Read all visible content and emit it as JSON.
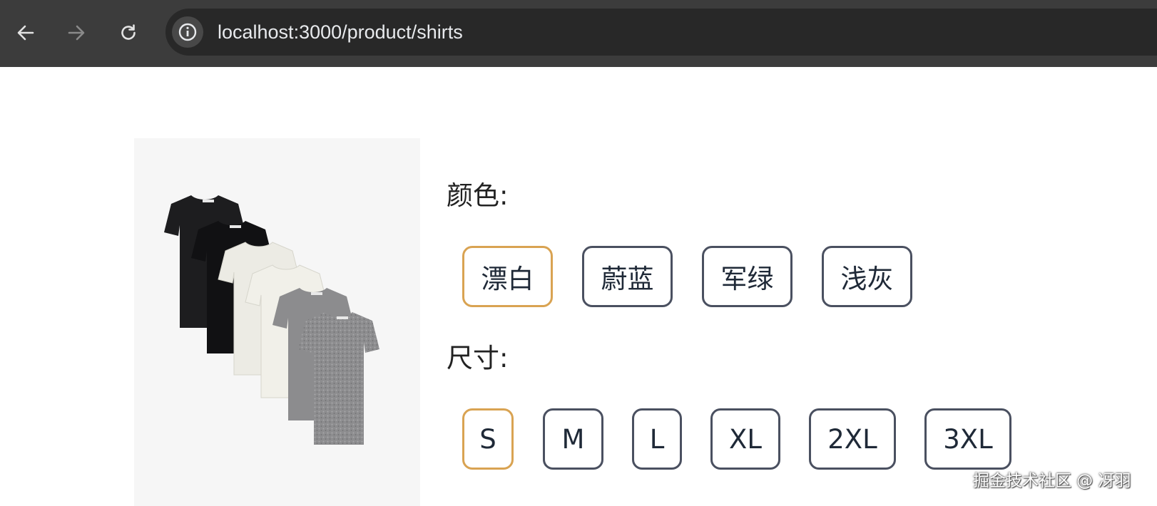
{
  "browser": {
    "url": "localhost:3000/product/shirts"
  },
  "product": {
    "image_alt": "T-shirts in black, off-white and grey",
    "color": {
      "label": "颜色:",
      "options": [
        "漂白",
        "蔚蓝",
        "军绿",
        "浅灰"
      ],
      "selected": "漂白"
    },
    "size": {
      "label": "尺寸:",
      "options": [
        "S",
        "M",
        "L",
        "XL",
        "2XL",
        "3XL"
      ],
      "selected": "S"
    }
  },
  "watermark": "掘金技术社区 @ 冴羽",
  "colors": {
    "selected_border": "#d9a352",
    "default_border": "#4a5060",
    "chrome_bg": "#3c3c3c",
    "omnibox_bg": "#282828"
  },
  "icons": [
    "back-arrow-icon",
    "forward-arrow-icon",
    "reload-icon",
    "info-icon"
  ]
}
